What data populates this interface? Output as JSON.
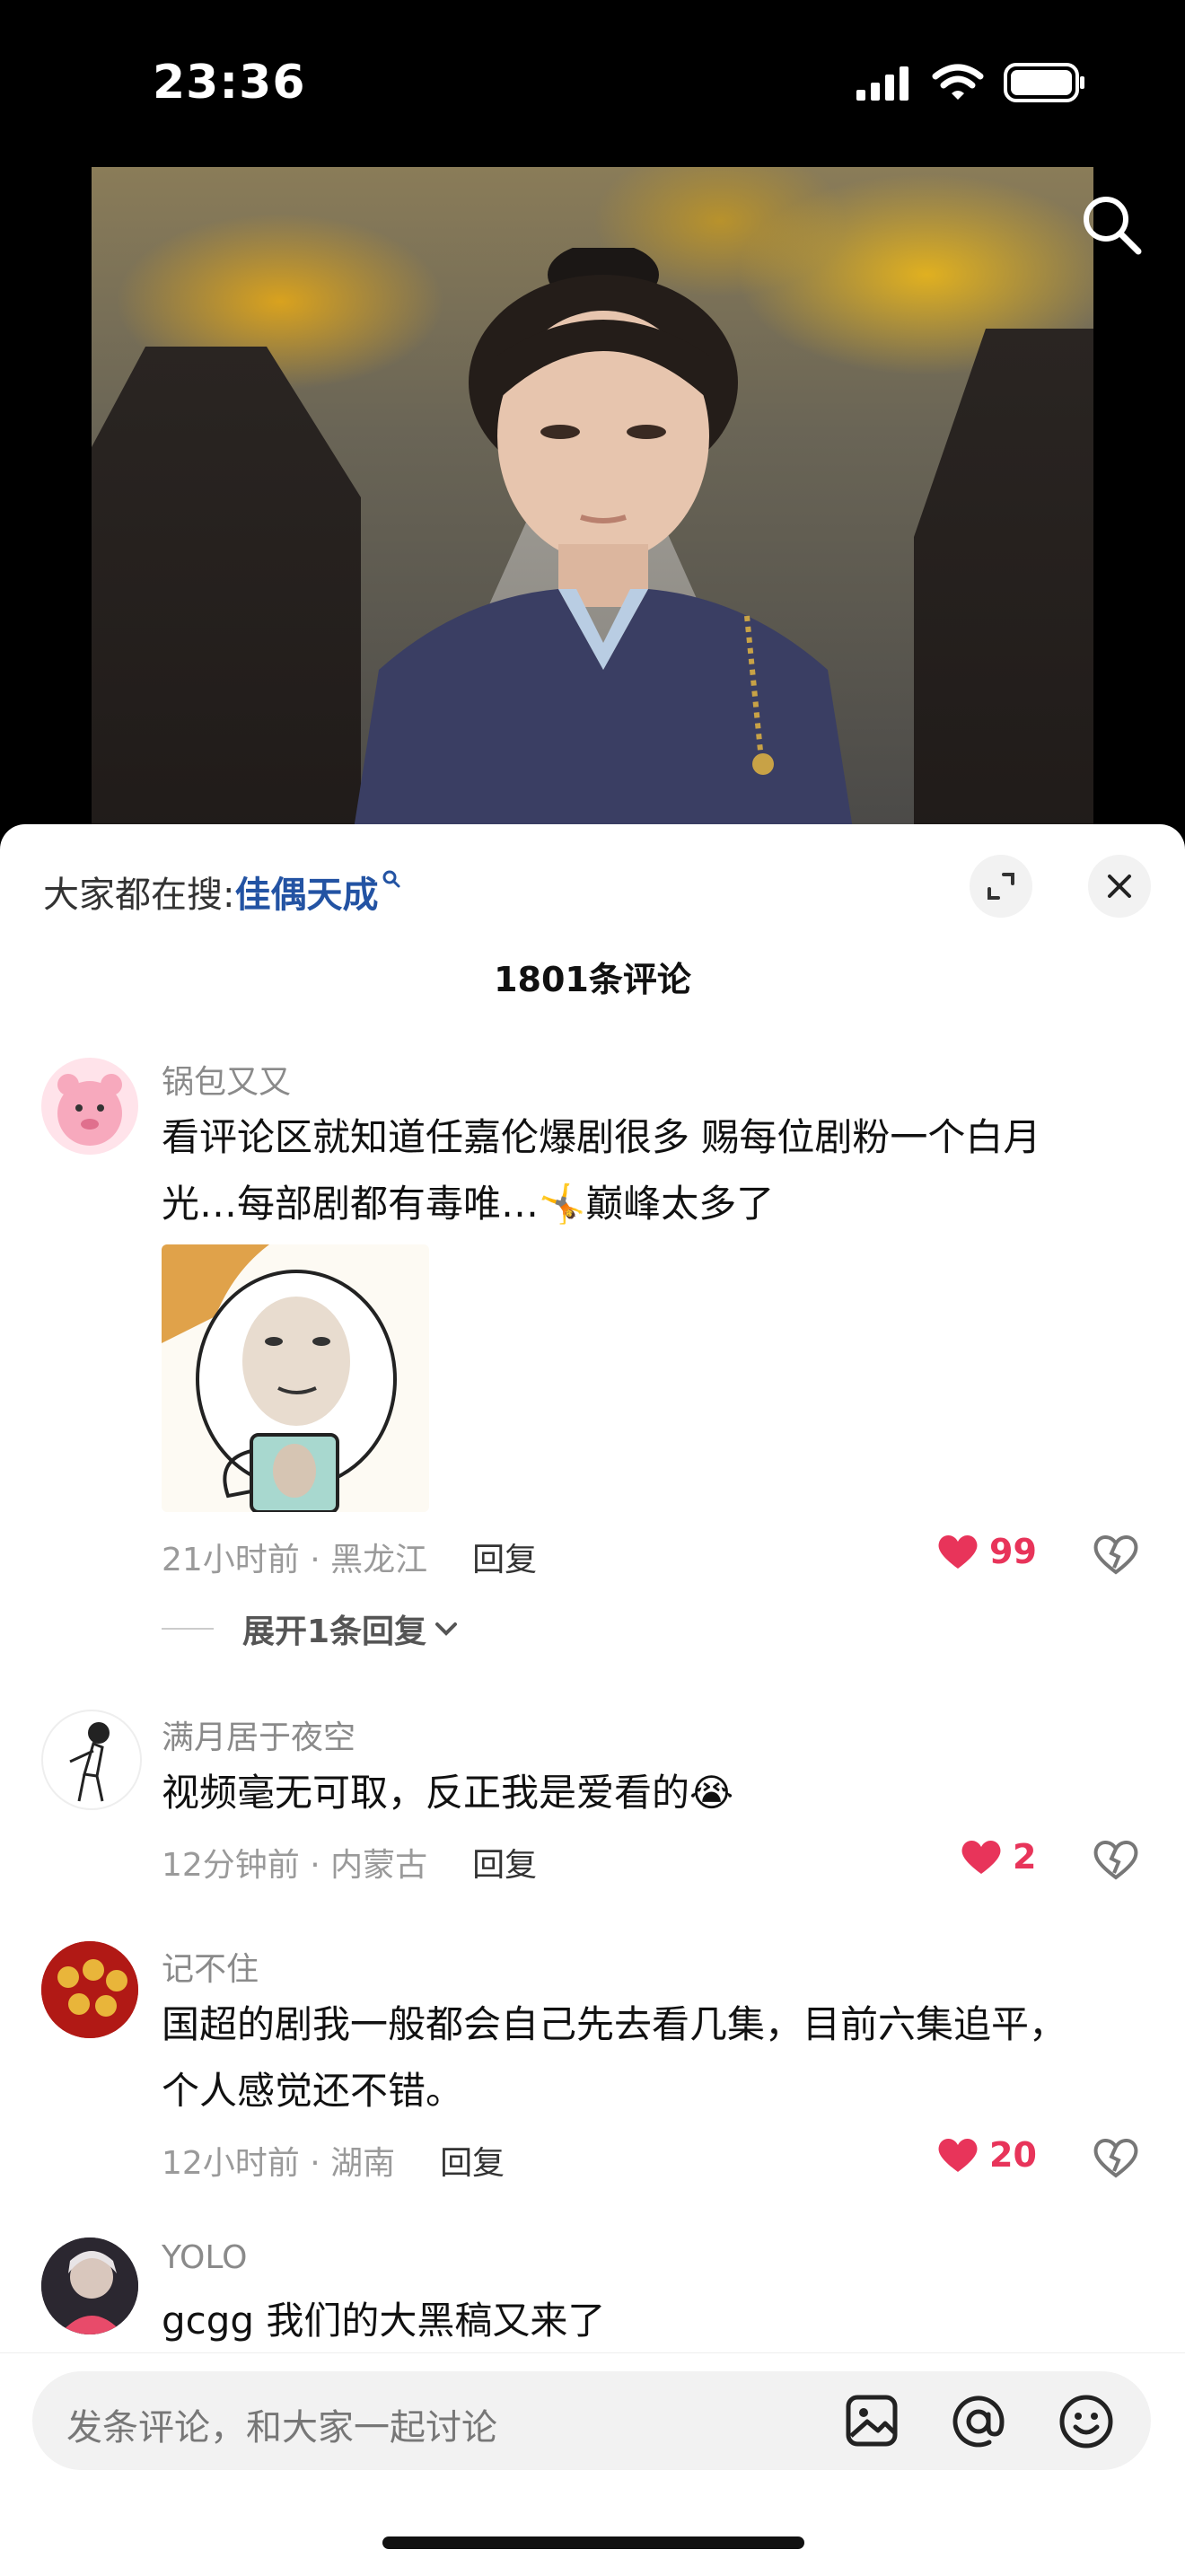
{
  "status_bar": {
    "time": "23:36"
  },
  "panel": {
    "search_prefix": "大家都在搜:",
    "search_keyword": "佳偶天成",
    "comment_count": "1801条评论"
  },
  "comments": [
    {
      "name": "锅包又又",
      "text": "看评论区就知道任嘉伦爆剧很多 赐每位剧粉一个白月光…每部剧都有毒唯…🤸巅峰太多了",
      "time_loc": "21小时前 · 黑龙江",
      "reply": "回复",
      "likes": "99",
      "expand": "展开1条回复"
    },
    {
      "name": "满月居于夜空",
      "text": "视频毫无可取，反正我是爱看的😭",
      "time_loc": "12分钟前 · 内蒙古",
      "reply": "回复",
      "likes": "2"
    },
    {
      "name": "记不住",
      "text": "国超的剧我一般都会自己先去看几集，目前六集追平，个人感觉还不错。",
      "time_loc": "12小时前 · 湖南",
      "reply": "回复",
      "likes": "20"
    },
    {
      "name": "YOLO",
      "text": "gcgg 我们的大黑稿又来了"
    }
  ],
  "input": {
    "placeholder": "发条评论，和大家一起讨论"
  },
  "colors": {
    "like": "#e8345a",
    "keyword": "#2353a3"
  }
}
